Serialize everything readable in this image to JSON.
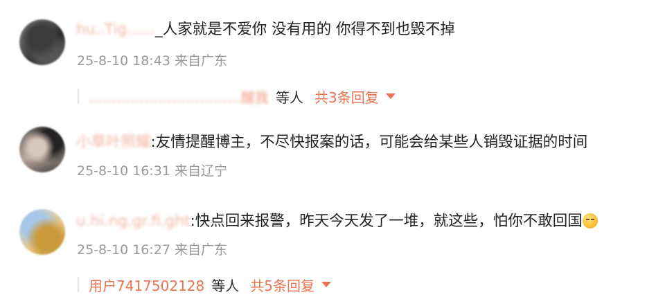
{
  "comments": [
    {
      "avatar_icon": "user-avatar",
      "username": "hu..Tig......",
      "separator": "_",
      "text": "人家就是不爱你 没有用的 你得不到也毁不掉",
      "meta": "25-8-10 18:43 来自广东",
      "replies": {
        "replier": "……………………………醒我",
        "among": "等人",
        "total": "共3条回复"
      }
    },
    {
      "avatar_icon": "user-avatar",
      "username": "小草叶照耀",
      "separator": ":",
      "text": "友情提醒博主，不尽快报案的话，可能会给某些人销毁证据的时间",
      "meta": "25-8-10 16:31 来自辽宁"
    },
    {
      "avatar_icon": "user-avatar",
      "username": "u.hi.ng.gr.fi.ght",
      "separator": ":",
      "text": "快点回来报警，昨天今天发了一堆，就这些，怕你不敢回国",
      "emoji_icon": "sweat-smile-emoji-icon",
      "meta": "25-8-10 16:27 来自广东",
      "replies": {
        "replier": "用户7417502128",
        "among": "等人",
        "total": "共5条回复"
      }
    }
  ],
  "colors": {
    "link": "#eb7350",
    "meta": "#999999",
    "text": "#222222"
  }
}
